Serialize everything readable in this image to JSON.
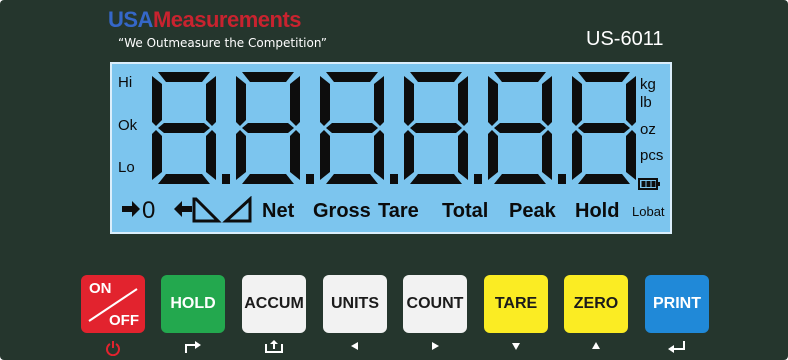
{
  "brand": {
    "name_part1": "USA",
    "name_part2": "Measurements",
    "tagline": "“We Outmeasure the Competition”",
    "model": "US-6011",
    "colors": {
      "usa": "#3567c8",
      "measurements": "#c8232f"
    }
  },
  "display": {
    "left_indicators": [
      "Hi",
      "Ok",
      "Lo"
    ],
    "units": [
      "kg",
      "lb",
      "oz",
      "pcs"
    ],
    "lobat_label": "Lobat",
    "status_labels": [
      "Net",
      "Gross",
      "Tare",
      "Total",
      "Peak",
      "Hold"
    ],
    "zero_indicator": "zero-arrows-icon",
    "stable_indicator": "triangle-icons",
    "digit_count": 6,
    "lcd_color": "#7cc5ee"
  },
  "keypad": {
    "on_off": {
      "line1": "ON",
      "line2": "OFF",
      "sub_icon": "power-icon"
    },
    "hold": {
      "label": "HOLD",
      "sub_icon": "enter-right-icon"
    },
    "accum": {
      "label": "ACCUM",
      "sub_icon": "tray-icon"
    },
    "units": {
      "label": "UNITS",
      "sub_icon": "arrow-left-icon"
    },
    "count": {
      "label": "COUNT",
      "sub_icon": "arrow-right-icon"
    },
    "tare": {
      "label": "TARE",
      "sub_icon": "arrow-down-icon"
    },
    "zero": {
      "label": "ZERO",
      "sub_icon": "arrow-up-icon"
    },
    "print": {
      "label": "PRINT",
      "sub_icon": "return-icon"
    }
  }
}
